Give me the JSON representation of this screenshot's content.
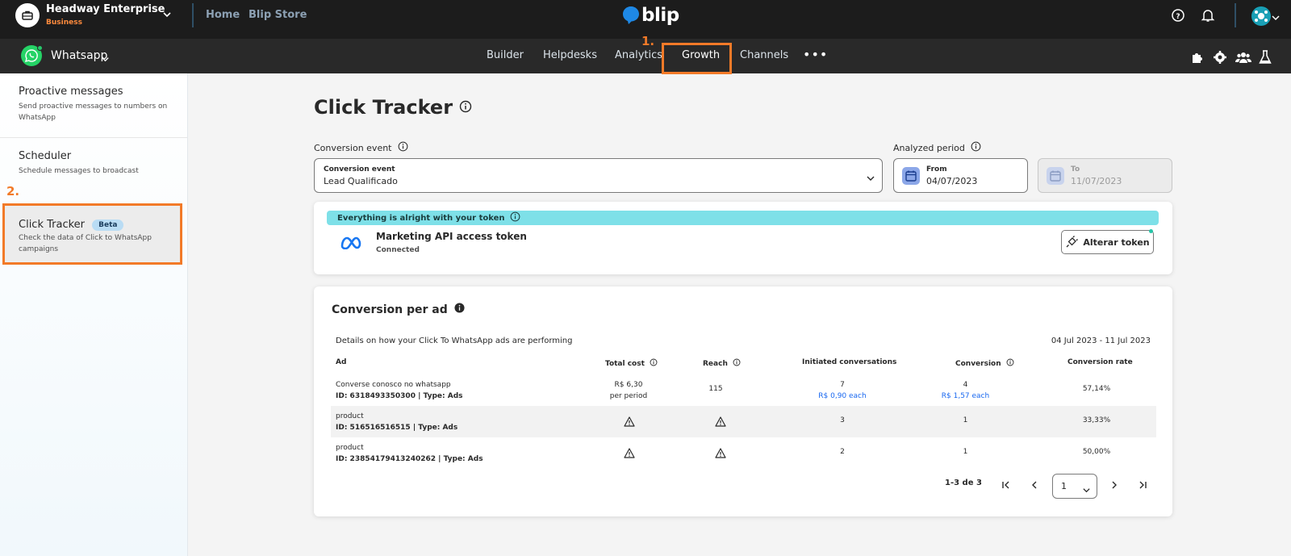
{
  "topbar": {
    "org_name": "Headway Enterprise",
    "org_plan": "Business",
    "links": [
      "Home",
      "Blip Store"
    ],
    "brand": "blip",
    "icons": [
      "help-icon",
      "bell-icon",
      "user-avatar"
    ]
  },
  "subbar": {
    "bot_name": "Whatsapp",
    "tabs": [
      "Builder",
      "Helpdesks",
      "Analytics",
      "Growth",
      "Channels"
    ],
    "active_tab": "Growth",
    "more": "•••",
    "icons": [
      "puzzle-icon",
      "gear-icon",
      "team-icon",
      "flask-icon"
    ]
  },
  "annotations": {
    "step1": "1.",
    "step2": "2."
  },
  "sidebar": {
    "items": [
      {
        "title": "Proactive messages",
        "desc": "Send proactive messages to numbers on WhatsApp"
      },
      {
        "title": "Scheduler",
        "desc": "Schedule messages to broadcast"
      },
      {
        "title": "Click Tracker",
        "badge": "Beta",
        "desc": "Check the data of Click to WhatsApp campaigns"
      }
    ]
  },
  "main": {
    "title": "Click Tracker",
    "conversion_event_label": "Conversion event",
    "conversion_event_field_label": "Conversion event",
    "conversion_event_value": "Lead Qualificado",
    "analyzed_period_label": "Analyzed period",
    "from_label": "From",
    "from_value": "04/07/2023",
    "to_label": "To",
    "to_value": "11/07/2023"
  },
  "token_card": {
    "banner": "Everything is alright with your token",
    "title": "Marketing API access token",
    "status": "Connected",
    "button": "Alterar token"
  },
  "conversion_card": {
    "title": "Conversion per ad",
    "description": "Details on how your Click To WhatsApp ads are performing",
    "range": "04 Jul 2023  -  11 Jul 2023",
    "columns": [
      "Ad",
      "Total cost",
      "Reach",
      "Initiated conversations",
      "Conversion",
      "Conversion rate"
    ],
    "rows": [
      {
        "ad": "Converse conosco no whatsapp",
        "id": "ID: 6318493350300 | Type: Ads",
        "cost": "R$ 6,30",
        "cost_sub": "per period",
        "reach": "115",
        "conversations": "7",
        "conversations_sub": "R$ 0,90 each",
        "conversion": "4",
        "conversion_sub": "R$ 1,57 each",
        "rate": "57,14%"
      },
      {
        "ad": "product",
        "id": "ID: 516516516515 | Type: Ads",
        "cost": "",
        "reach": "",
        "conversations": "3",
        "conversion": "1",
        "rate": "33,33%"
      },
      {
        "ad": "product",
        "id": "ID: 23854179413240262 | Type: Ads",
        "cost": "",
        "reach": "",
        "conversations": "2",
        "conversion": "1",
        "rate": "50,00%"
      }
    ],
    "pager_text": "1-3 de 3",
    "page_value": "1"
  },
  "colors": {
    "accent_orange": "#f27a28",
    "topbar": "#1c1c1c",
    "subbar": "#292929",
    "banner": "#7ee0e8",
    "link_blue": "#1968f0"
  }
}
